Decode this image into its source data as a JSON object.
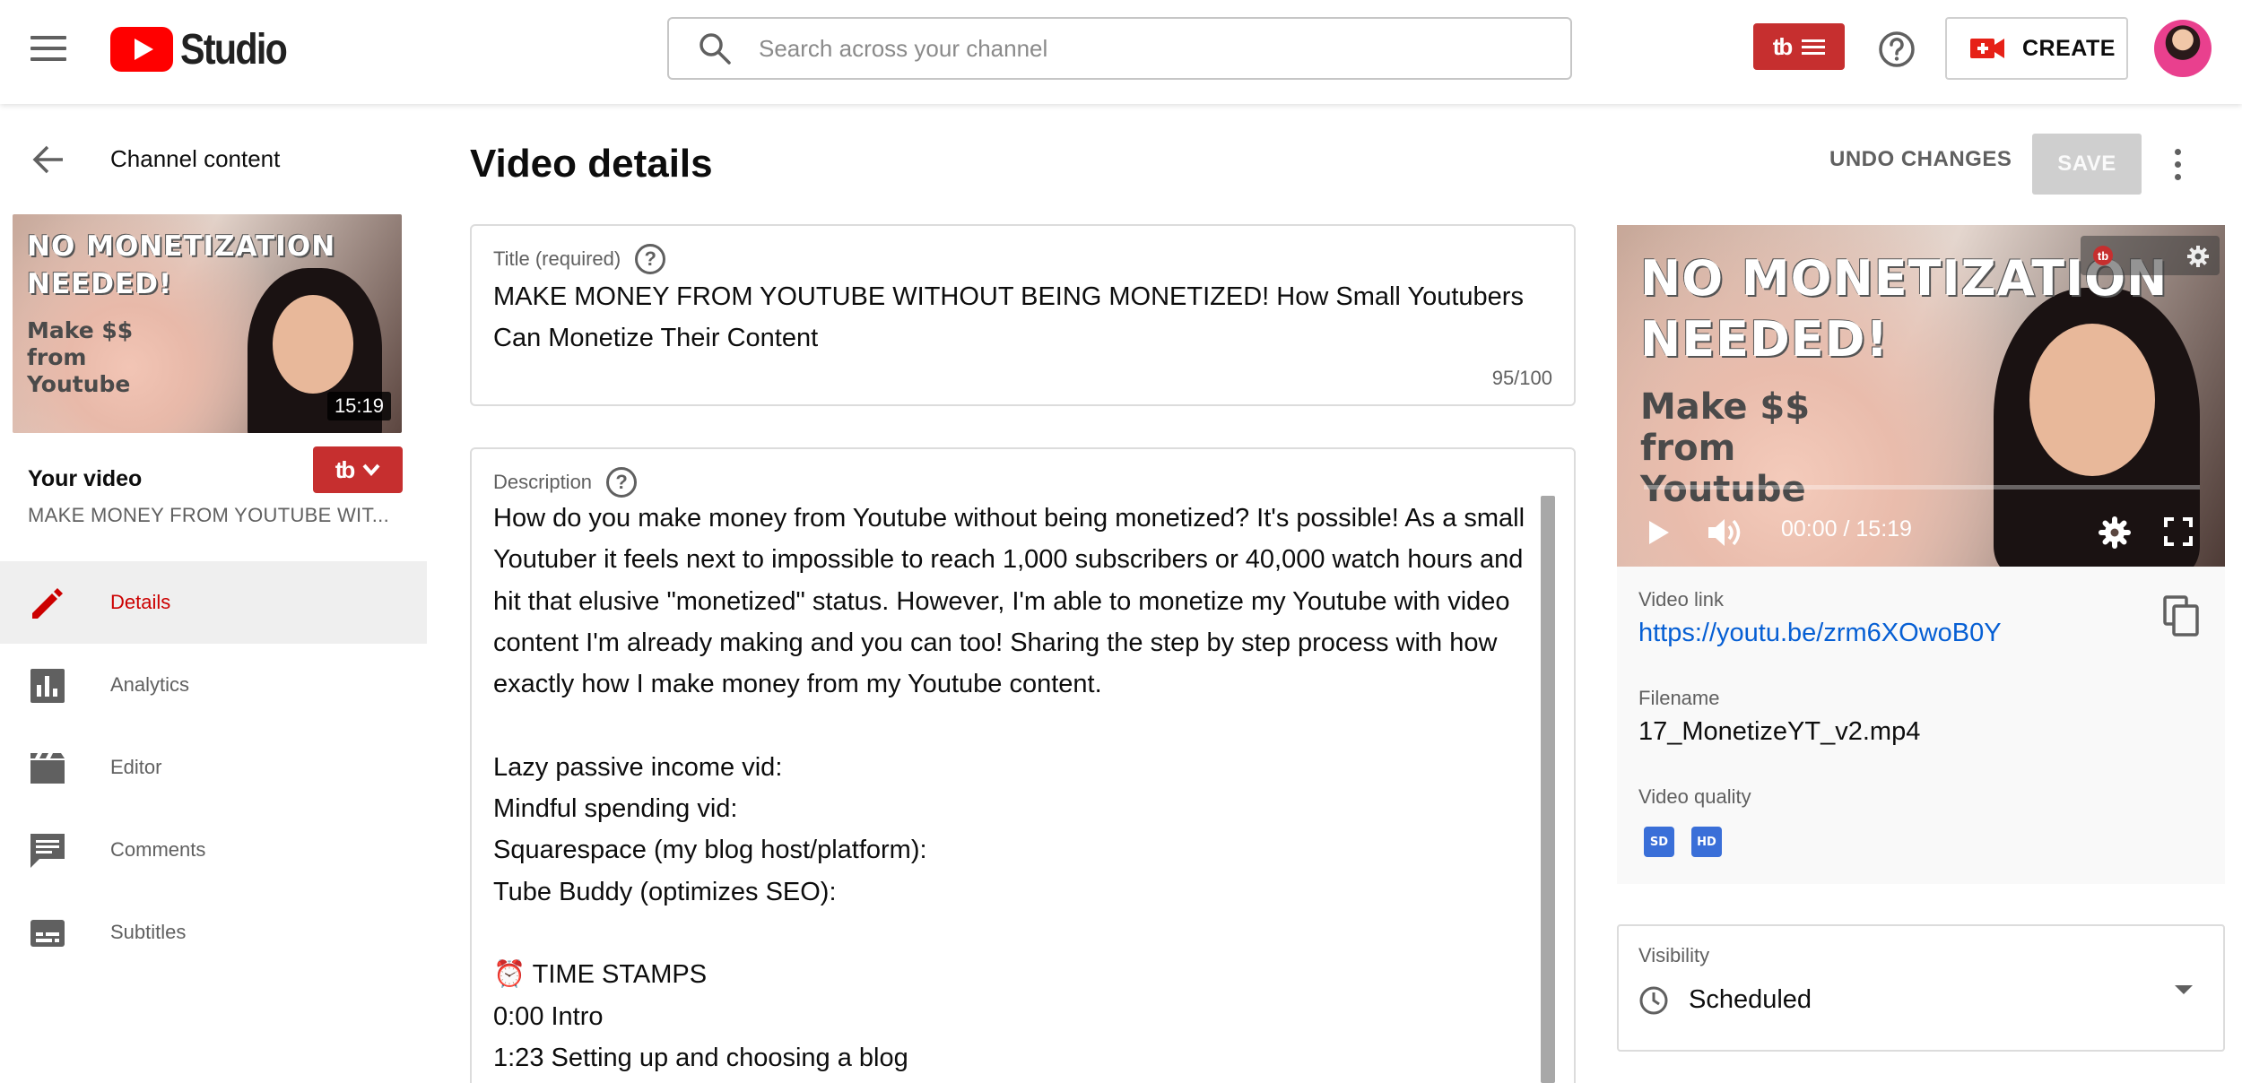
{
  "header": {
    "logo_text": "Studio",
    "search_placeholder": "Search across your channel",
    "tubebuddy_mark": "tb",
    "create_label": "CREATE"
  },
  "sidebar": {
    "back_label": "Channel content",
    "thumbnail": {
      "headline_1": "NO MONETIZATION",
      "headline_2": "NEEDED!",
      "sub_1": "Make $$",
      "sub_2": "from",
      "sub_3": "Youtube",
      "duration": "15:19"
    },
    "your_video_label": "Your video",
    "video_title_short": "MAKE MONEY FROM YOUTUBE WIT...",
    "items": [
      {
        "label": "Details",
        "icon": "pencil-icon",
        "active": true
      },
      {
        "label": "Analytics",
        "icon": "bar-chart-icon",
        "active": false
      },
      {
        "label": "Editor",
        "icon": "clapperboard-icon",
        "active": false
      },
      {
        "label": "Comments",
        "icon": "comment-icon",
        "active": false
      },
      {
        "label": "Subtitles",
        "icon": "subtitles-icon",
        "active": false
      }
    ]
  },
  "main": {
    "page_title": "Video details",
    "undo_label": "UNDO CHANGES",
    "save_label": "SAVE",
    "title_field": {
      "label": "Title (required)",
      "value": "MAKE MONEY FROM YOUTUBE WITHOUT BEING MONETIZED! How Small Youtubers Can Monetize Their Content",
      "counter": "95/100"
    },
    "description_field": {
      "label": "Description",
      "lines": [
        "How do you make money from Youtube without being monetized? It's possible! As a small Youtuber it feels next to impossible to reach 1,000 subscribers or 40,000 watch hours and hit that elusive \"monetized\" status. However, I'm able to monetize my Youtube with video content I'm already making and you can too! Sharing the step by step process with how exactly how I make money from my Youtube content.",
        "",
        "Lazy passive income vid:",
        "Mindful spending vid:",
        "Squarespace (my blog host/platform):",
        "Tube Buddy (optimizes SEO):",
        "",
        "⏰ TIME STAMPS",
        "0:00 Intro",
        "1:23 Setting up and choosing a blog"
      ]
    }
  },
  "right_panel": {
    "preview": {
      "headline_1": "NO MONETIZATION",
      "headline_2": "NEEDED!",
      "sub_1": "Make $$",
      "sub_2": "from",
      "sub_3": "Youtube",
      "time": "00:00 / 15:19",
      "progress": 0
    },
    "video_link_label": "Video link",
    "video_link": "https://youtu.be/zrm6XOwoB0Y",
    "filename_label": "Filename",
    "filename": "17_MonetizeYT_v2.mp4",
    "quality_label": "Video quality",
    "quality_badges": [
      "SD",
      "HD"
    ],
    "visibility_label": "Visibility",
    "visibility_value": "Scheduled"
  },
  "colors": {
    "brand_red": "#ff0000",
    "tubebuddy_red": "#c62f2f",
    "active_nav": "#cc0000",
    "link_blue": "#065fd4",
    "quality_badge_blue": "#3a6fd8"
  }
}
